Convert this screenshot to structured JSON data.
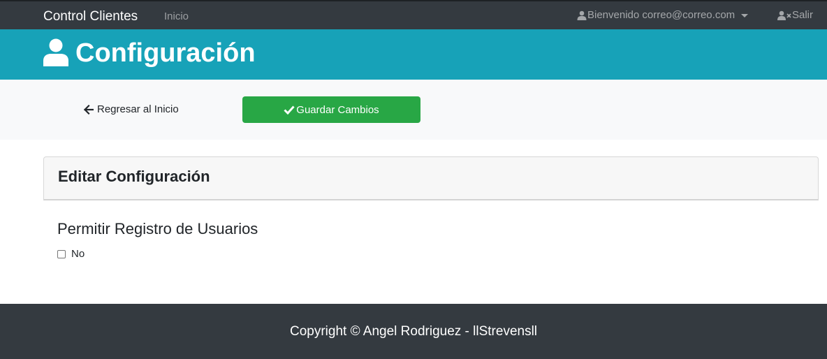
{
  "navbar": {
    "brand": "Control Clientes",
    "home_link": "Inicio",
    "user_menu": "Bienvenido correo@correo.com",
    "logout": "Salir",
    "user_icon": "user-icon",
    "logout_icon": "user-times-icon"
  },
  "header": {
    "title": "Configuración",
    "icon": "user-icon",
    "background": "#17a2b8"
  },
  "actions": {
    "back_label": "Regresar al Inicio",
    "back_icon": "arrow-left-icon",
    "save_label": "Guardar Cambios",
    "save_icon": "check-icon",
    "save_color": "#28a745"
  },
  "card": {
    "title": "Editar Configuración"
  },
  "form": {
    "section_title": "Permitir Registro de Usuarios",
    "checkbox_label": "No",
    "checkbox_checked": false
  },
  "footer": {
    "text": "Copyright © Angel Rodriguez - llStrevensll"
  }
}
